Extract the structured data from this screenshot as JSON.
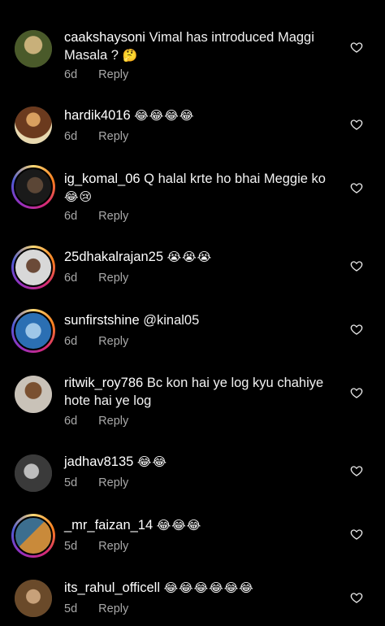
{
  "comments": [
    {
      "username": "caakshaysoni",
      "text": "Vimal has introduced Maggi Masala ?",
      "emoji": "🤔",
      "time": "6d",
      "reply": "Reply",
      "avatar_colors": [
        "#4a5a2a",
        "#c8b07a"
      ]
    },
    {
      "username": "hardik4016",
      "text": "",
      "emoji": "😂😂😂😂",
      "time": "6d",
      "reply": "Reply",
      "avatar_colors": [
        "#6b3a1e",
        "#d9a060"
      ]
    },
    {
      "username": "ig_komal_06",
      "text": "Q halal krte ho bhai Meggie ko",
      "emoji": "😂😢",
      "time": "6d",
      "reply": "Reply",
      "avatar_colors": [
        "#1a1a1a",
        "#5b4636"
      ]
    },
    {
      "username": "25dhakalrajan25",
      "text": "",
      "emoji": "😭😭😭",
      "time": "6d",
      "reply": "Reply",
      "avatar_colors": [
        "#d8d8d8",
        "#6b4a38"
      ]
    },
    {
      "username": "sunfirstshine",
      "text": "@kinal05",
      "emoji": "",
      "time": "6d",
      "reply": "Reply",
      "avatar_colors": [
        "#2b6fb3",
        "#9fc7e8"
      ]
    },
    {
      "username": "ritwik_roy786",
      "text": "Bc kon hai ye log kyu chahiye hote hai ye log",
      "emoji": "",
      "time": "6d",
      "reply": "Reply",
      "avatar_colors": [
        "#c9c2b8",
        "#7a5030"
      ]
    },
    {
      "username": "jadhav8135",
      "text": "",
      "emoji": "😂😂",
      "time": "5d",
      "reply": "Reply",
      "avatar_colors": [
        "#3a3a3a",
        "#bdbdbd"
      ]
    },
    {
      "username": "_mr_faizan_14",
      "text": "",
      "emoji": "😂😂😂",
      "time": "5d",
      "reply": "Reply",
      "avatar_colors": [
        "#3c6e8f",
        "#c98a3a"
      ]
    },
    {
      "username": "its_rahul_officell",
      "text": "",
      "emoji": "😂😂😂😂😂😂",
      "time": "5d",
      "reply": "Reply",
      "avatar_colors": [
        "#6a4a2a",
        "#c7a17a"
      ]
    }
  ]
}
